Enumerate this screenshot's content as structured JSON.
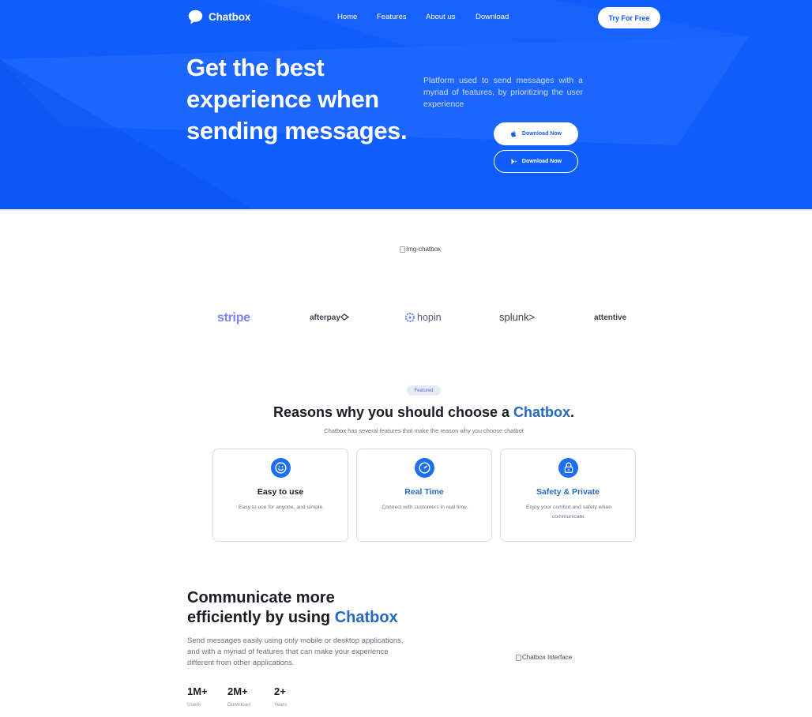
{
  "brand": {
    "name": "Chatbox",
    "accent_color": "#0f5dfd",
    "text_accent_color": "#2469c0"
  },
  "nav": {
    "links": [
      "Home",
      "Features",
      "About us",
      "Download"
    ],
    "cta": "Try For Free"
  },
  "hero": {
    "title": "Get the best experience when sending messages.",
    "description": "Platform used to send messages with a myriad of features, by prioritizing the user experience",
    "download_primary": "Download Now",
    "download_secondary": "Download Now",
    "download_primary_icon": "apple-icon",
    "download_secondary_icon": "play-store-icon"
  },
  "images": {
    "main_alt": "Img-chatbox",
    "interface_alt": "Chatbox Interface"
  },
  "partners": [
    "stripe",
    "afterpay",
    "hopin",
    "splunk>",
    "attentive"
  ],
  "featured": {
    "badge": "Featured",
    "title_prefix": "Reasons why you should choose a ",
    "title_accent": "Chatbox",
    "title_suffix": ".",
    "subtitle": "Chatbox has several features that make the reason why you choose chatbot",
    "cards": [
      {
        "icon": "smile-icon",
        "title": "Easy to use",
        "description": "Easy to use for anyone, and simple."
      },
      {
        "icon": "clock-icon",
        "title": "Real Time",
        "description": "Connect with customers in real time."
      },
      {
        "icon": "lock-icon",
        "title": "Safety & Private",
        "description": "Enjoy your comfort and safety when communicate."
      }
    ]
  },
  "communicate": {
    "title_line1": "Communicate more",
    "title_prefix": "efficiently by using ",
    "title_accent": "Chatbox",
    "description": "Send messages easily using only mobile or desktop applications, and with a myriad of features that can make your experience different from other applications.",
    "stats": [
      {
        "value": "1M+",
        "label": "Users"
      },
      {
        "value": "2M+",
        "label": "Download"
      },
      {
        "value": "2+",
        "label": "Years"
      }
    ]
  }
}
